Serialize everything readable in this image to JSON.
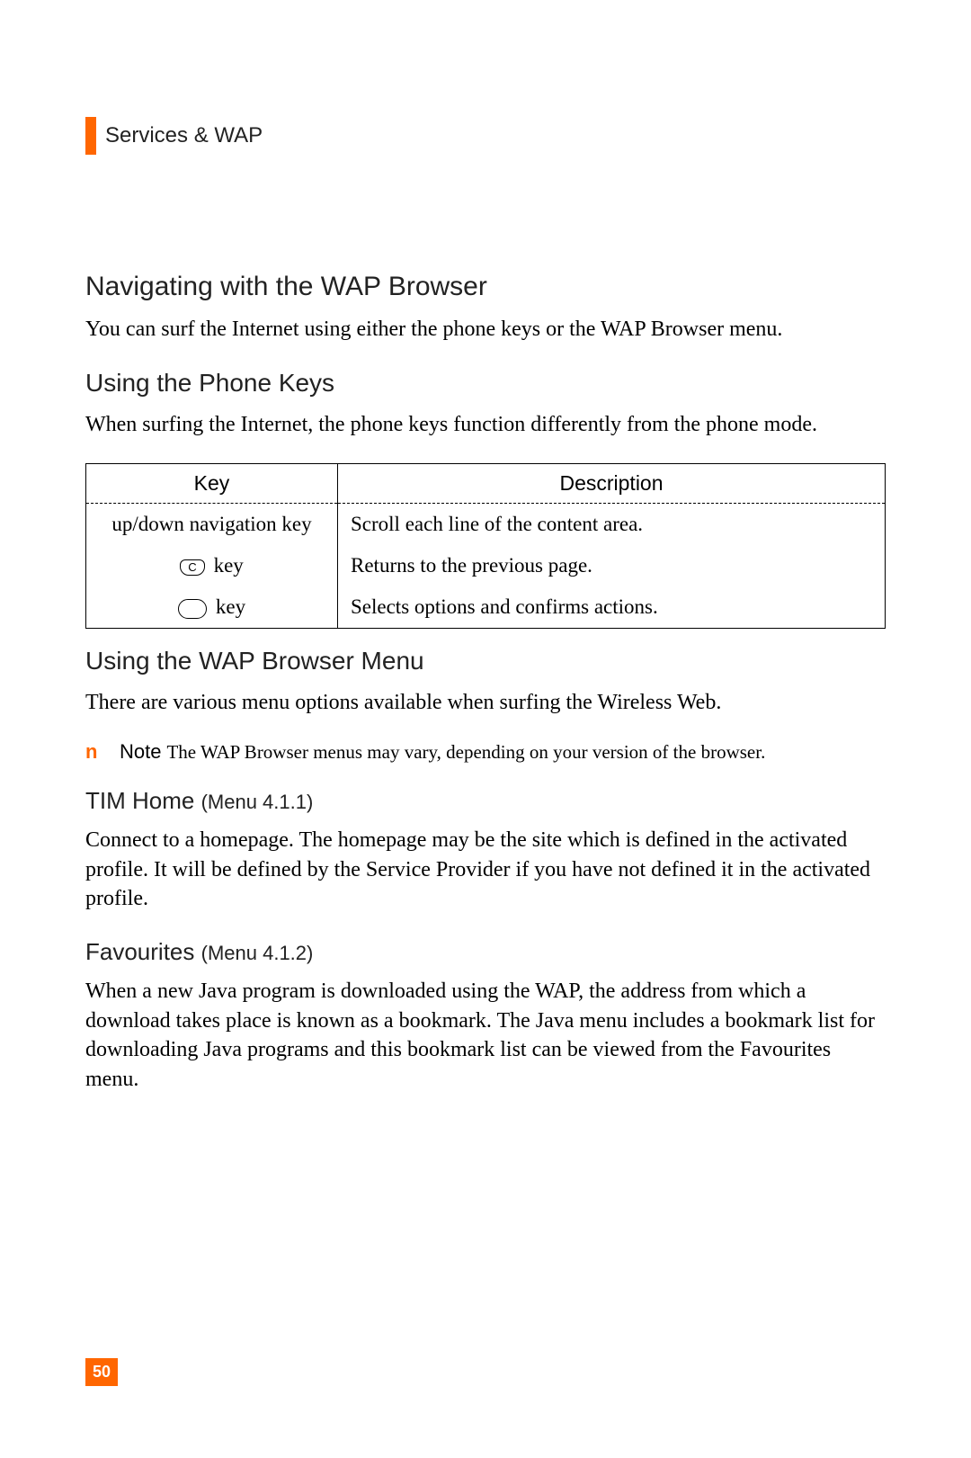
{
  "header": {
    "section_title": "Services & WAP"
  },
  "h1": "Navigating with the WAP Browser",
  "p1": "You can surf the Internet using either the phone keys or the WAP Browser menu.",
  "h2a": "Using the Phone Keys",
  "p2": "When surfing the Internet, the phone keys function differently from the phone mode.",
  "table": {
    "headers": {
      "key": "Key",
      "desc": "Description"
    },
    "rows": [
      {
        "key": "up/down navigation key",
        "desc": "Scroll each line of the content area."
      },
      {
        "key_icon": "C",
        "key_label": "key",
        "desc": "Returns to the previous page."
      },
      {
        "key_icon": "round",
        "key_label": "key",
        "desc": "Selects options and confirms actions."
      }
    ]
  },
  "h2b": "Using the WAP Browser Menu",
  "p3": "There are various menu options available when surfing the Wireless Web.",
  "note": {
    "marker": "n",
    "label": "Note",
    "text": "The WAP Browser menus may vary, depending on your version of the browser."
  },
  "h3a": {
    "title": "TIM Home",
    "ref": "(Menu 4.1.1)"
  },
  "p4": "Connect to a homepage. The homepage may be the site which is defined in the activated profile. It will be defined by the Service Provider if you have not defined it in the activated profile.",
  "h3b": {
    "title": "Favourites",
    "ref": "(Menu 4.1.2)"
  },
  "p5": "When a new Java program is downloaded using the WAP, the address from which a download takes place is known as a bookmark. The Java menu includes a bookmark list for downloading Java programs and this bookmark list can be viewed from the Favourites menu.",
  "page_number": "50"
}
